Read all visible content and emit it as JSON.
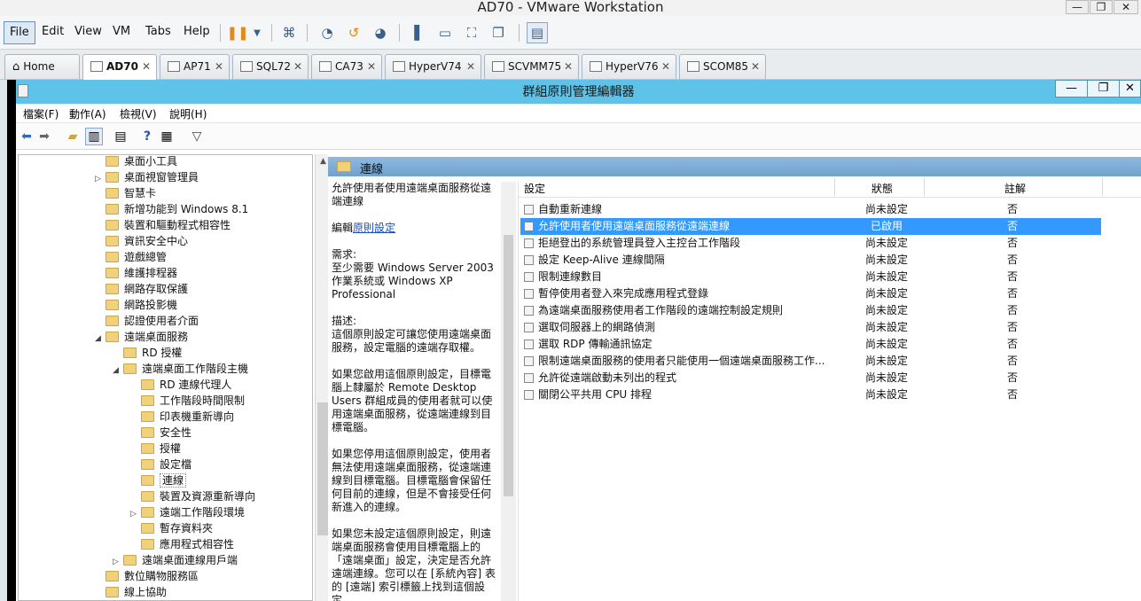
{
  "vmware": {
    "title": "AD70 - VMware Workstation",
    "menu": [
      "File",
      "Edit",
      "View",
      "VM",
      "Tabs",
      "Help"
    ],
    "win_buttons": [
      "—",
      "❐",
      "✕"
    ],
    "tabs": [
      "Home",
      "AD70",
      "AP71",
      "SQL72",
      "CA73",
      "HyperV74",
      "SCVMM75",
      "HyperV76",
      "SCOM85"
    ],
    "tab_close": "✕"
  },
  "gpm": {
    "title": "群組原則管理編輯器",
    "win_buttons": [
      "—",
      "❐",
      "✕"
    ],
    "menu": [
      "檔案(F)",
      "動作(A)",
      "檢視(V)",
      "說明(H)"
    ],
    "tree": [
      {
        "label": "桌面小工具",
        "level": 0,
        "arrow": ""
      },
      {
        "label": "桌面視窗管理員",
        "level": 0,
        "arrow": "▷"
      },
      {
        "label": "智慧卡",
        "level": 0,
        "arrow": ""
      },
      {
        "label": "新增功能到 Windows 8.1",
        "level": 0,
        "arrow": ""
      },
      {
        "label": "裝置和驅動程式相容性",
        "level": 0,
        "arrow": ""
      },
      {
        "label": "資訊安全中心",
        "level": 0,
        "arrow": ""
      },
      {
        "label": "遊戲總管",
        "level": 0,
        "arrow": ""
      },
      {
        "label": "維護排程器",
        "level": 0,
        "arrow": ""
      },
      {
        "label": "網路存取保護",
        "level": 0,
        "arrow": ""
      },
      {
        "label": "網路投影機",
        "level": 0,
        "arrow": ""
      },
      {
        "label": "認證使用者介面",
        "level": 0,
        "arrow": ""
      },
      {
        "label": "遠端桌面服務",
        "level": 0,
        "arrow": "◢"
      },
      {
        "label": "RD 授權",
        "level": 1,
        "arrow": ""
      },
      {
        "label": "遠端桌面工作階段主機",
        "level": 1,
        "arrow": "◢"
      },
      {
        "label": "RD 連線代理人",
        "level": 2,
        "arrow": ""
      },
      {
        "label": "工作階段時間限制",
        "level": 2,
        "arrow": ""
      },
      {
        "label": "印表機重新導向",
        "level": 2,
        "arrow": ""
      },
      {
        "label": "安全性",
        "level": 2,
        "arrow": ""
      },
      {
        "label": "授權",
        "level": 2,
        "arrow": ""
      },
      {
        "label": "設定檔",
        "level": 2,
        "arrow": ""
      },
      {
        "label": "連線",
        "level": 2,
        "arrow": "",
        "selected": true
      },
      {
        "label": "裝置及資源重新導向",
        "level": 2,
        "arrow": ""
      },
      {
        "label": "遠端工作階段環境",
        "level": 2,
        "arrow": "▷"
      },
      {
        "label": "暫存資料夾",
        "level": 2,
        "arrow": ""
      },
      {
        "label": "應用程式相容性",
        "level": 2,
        "arrow": ""
      },
      {
        "label": "遠端桌面連線用戶端",
        "level": 1,
        "arrow": "▷"
      },
      {
        "label": "數位購物服務區",
        "level": 0,
        "arrow": ""
      },
      {
        "label": "線上協助",
        "level": 0,
        "arrow": ""
      }
    ],
    "right_title": "連線",
    "desc": {
      "policy_title": "允許使用者使用遠端桌面服務從遠端連線",
      "edit_prefix": "編輯",
      "edit_link": "原則設定",
      "req_label": "需求:",
      "req_text": "至少需要 Windows Server 2003 作業系統或 Windows XP Professional",
      "desc_label": "描述:",
      "p1": "這個原則設定可讓您使用遠端桌面服務，設定電腦的遠端存取權。",
      "p2": "如果您啟用這個原則設定，目標電腦上隸屬於 Remote Desktop Users 群組成員的使用者就可以使用遠端桌面服務，從遠端連線到目標電腦。",
      "p3": "如果您停用這個原則設定，使用者無法使用遠端桌面服務，從遠端連線到目標電腦。目標電腦會保留任何目前的連線，但是不會接受任何新進入的連線。",
      "p4": "如果您未設定這個原則設定，則遠端桌面服務會使用目標電腦上的「遠端桌面」設定，決定是否允許遠端連線。您可以在 [系統內容] 表的 [遠端] 索引標籤上找到這個設定。"
    },
    "columns": [
      "設定",
      "狀態",
      "註解"
    ],
    "rows": [
      {
        "setting": "自動重新連線",
        "state": "尚未設定",
        "comment": "否"
      },
      {
        "setting": "允許使用者使用遠端桌面服務從遠端連線",
        "state": "已啟用",
        "comment": "否",
        "selected": true
      },
      {
        "setting": "拒絕登出的系統管理員登入主控台工作階段",
        "state": "尚未設定",
        "comment": "否"
      },
      {
        "setting": "設定 Keep-Alive 連線間隔",
        "state": "尚未設定",
        "comment": "否"
      },
      {
        "setting": "限制連線數目",
        "state": "尚未設定",
        "comment": "否"
      },
      {
        "setting": "暫停使用者登入來完成應用程式登錄",
        "state": "尚未設定",
        "comment": "否"
      },
      {
        "setting": "為遠端桌面服務使用者工作階段的遠端控制設定規則",
        "state": "尚未設定",
        "comment": "否"
      },
      {
        "setting": "選取伺服器上的網路偵測",
        "state": "尚未設定",
        "comment": "否"
      },
      {
        "setting": "選取 RDP 傳輸通訊協定",
        "state": "尚未設定",
        "comment": "否"
      },
      {
        "setting": "限制遠端桌面服務的使用者只能使用一個遠端桌面服務工作...",
        "state": "尚未設定",
        "comment": "否"
      },
      {
        "setting": "允許從遠端啟動未列出的程式",
        "state": "尚未設定",
        "comment": "否"
      },
      {
        "setting": "關閉公平共用 CPU 排程",
        "state": "尚未設定",
        "comment": "否"
      }
    ]
  }
}
